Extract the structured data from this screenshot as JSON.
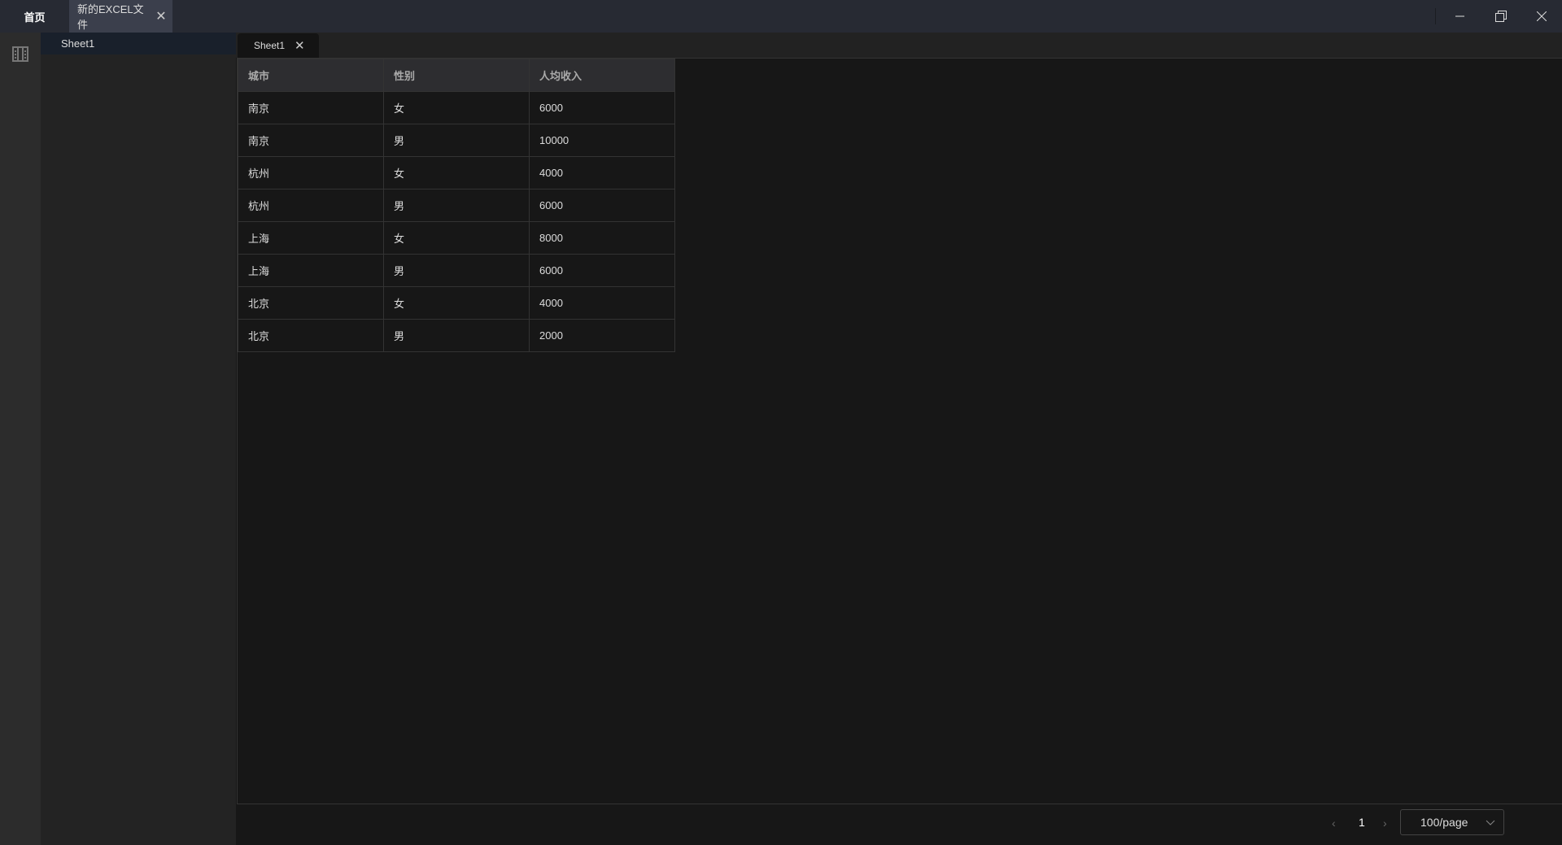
{
  "titlebar": {
    "tabs": [
      {
        "label": "首页"
      },
      {
        "label": "新的EXCEL文件"
      }
    ]
  },
  "sidebar": {
    "items": [
      {
        "label": "Sheet1"
      }
    ]
  },
  "sheet_tabs": [
    {
      "label": "Sheet1"
    }
  ],
  "table": {
    "headers": [
      "城市",
      "性别",
      "人均收入"
    ],
    "rows": [
      [
        "南京",
        "女",
        "6000"
      ],
      [
        "南京",
        "男",
        "10000"
      ],
      [
        "杭州",
        "女",
        "4000"
      ],
      [
        "杭州",
        "男",
        "6000"
      ],
      [
        "上海",
        "女",
        "8000"
      ],
      [
        "上海",
        "男",
        "6000"
      ],
      [
        "北京",
        "女",
        "4000"
      ],
      [
        "北京",
        "男",
        "2000"
      ]
    ]
  },
  "pagination": {
    "current_page": "1",
    "page_size": "100/page"
  }
}
